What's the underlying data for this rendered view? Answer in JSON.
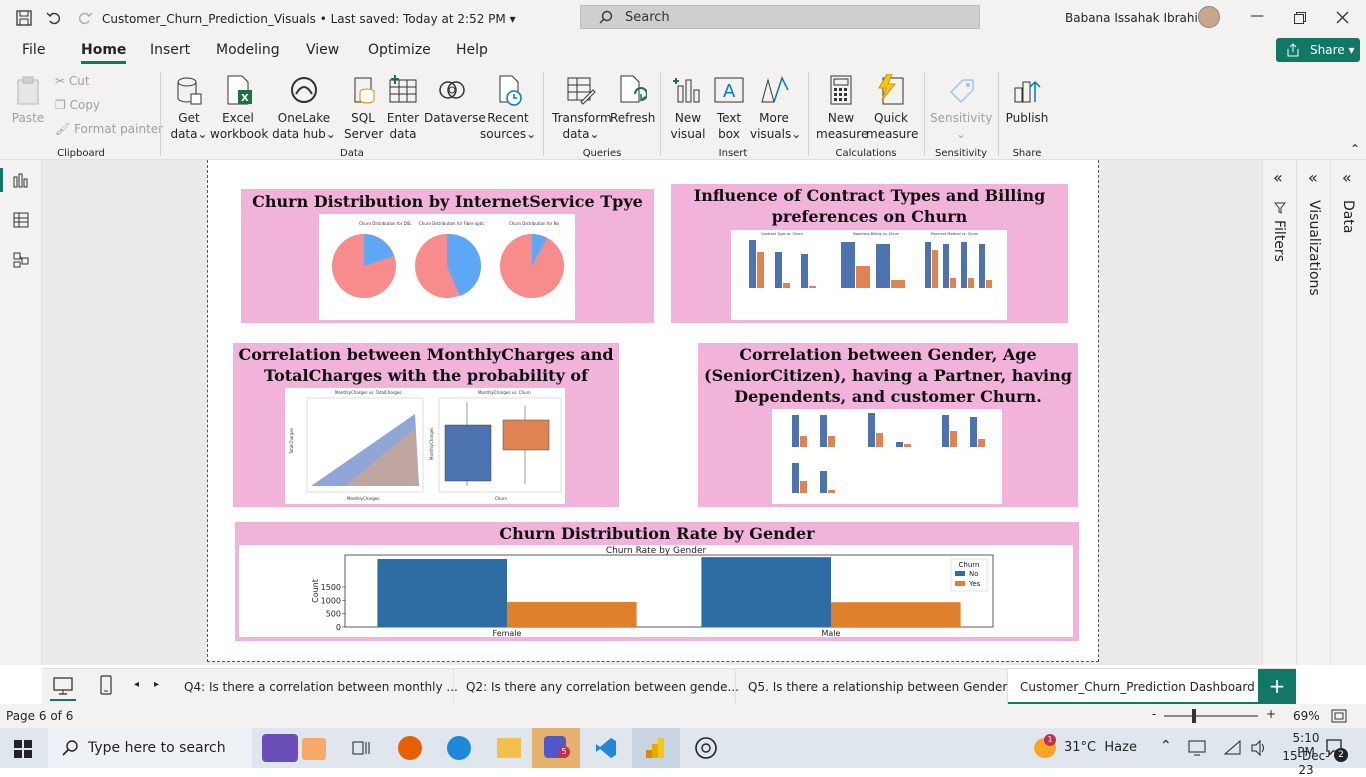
{
  "titlebar": {
    "doc_title": "Customer_Churn_Prediction_Visuals",
    "saved_status": "Last saved: Today at 2:52 PM",
    "search_placeholder": "Search",
    "user_name": "Babana Issahak Ibrahim"
  },
  "ribbon_tabs": [
    "File",
    "Home",
    "Insert",
    "Modeling",
    "View",
    "Optimize",
    "Help"
  ],
  "share_label": "Share",
  "clipboard": {
    "paste": "Paste",
    "cut": "Cut",
    "copy": "Copy",
    "format_painter": "Format painter",
    "group": "Clipboard"
  },
  "data_group": {
    "get_data": "Get data",
    "excel": "Excel workbook",
    "onelake": "OneLake data hub",
    "sql": "SQL Server",
    "enter": "Enter data",
    "dataverse": "Dataverse",
    "recent": "Recent sources",
    "group": "Data"
  },
  "queries": {
    "transform": "Transform data",
    "refresh": "Refresh",
    "group": "Queries"
  },
  "insert": {
    "new_visual": "New visual",
    "text_box": "Text box",
    "more_visuals": "More visuals",
    "group": "Insert"
  },
  "calculations": {
    "new_measure": "New measure",
    "quick_measure": "Quick measure",
    "group": "Calculations"
  },
  "sensitivity": {
    "label": "Sensitivity",
    "group": "Sensitivity"
  },
  "share_group": {
    "publish": "Publish",
    "group": "Share"
  },
  "panels": {
    "p1": {
      "title": "Churn Distribution by InternetService Tpye",
      "pie_titles": [
        "Churn Distribution for DSL",
        "Churn Distribution for Fiber optic",
        "Churn Distribution for No"
      ]
    },
    "p2": {
      "title_line1": "Influence of Contract Types and Billing",
      "title_line2": "preferences on Churn",
      "chart_titles": [
        "Contract Type vs. Churn",
        "Paperless Billing vs. Churn",
        "Payment Method vs. Churn"
      ]
    },
    "p3": {
      "title_line1": "Correlation between MonthlyCharges and",
      "title_line2": "TotalCharges with the probability of churning.",
      "scatter_title": "MonthlyCharges vs. TotalCharges",
      "box_title": "MonthlyCharges vs. Churn",
      "scatter_xlabel": "MonthlyCharges",
      "box_xlabel": "Churn",
      "box_ylabel": "MonthlyCharges",
      "scatter_ylabel": "TotalCharges"
    },
    "p4": {
      "title_line1": "Correlation between Gender, Age",
      "title_line2": "(SeniorCitizen), having a Partner, having",
      "title_line3": "Dependents, and customer Churn."
    },
    "p5": {
      "title": "Churn Distribution Rate by Gender"
    }
  },
  "chart_data": [
    {
      "type": "bar",
      "title": "Churn Rate by Gender",
      "categories": [
        "Female",
        "Male"
      ],
      "series": [
        {
          "name": "No",
          "values": [
            2550,
            2620
          ]
        },
        {
          "name": "Yes",
          "values": [
            940,
            930
          ]
        }
      ],
      "ylabel": "Count",
      "ylim": [
        0,
        2700
      ],
      "yticks": [
        0,
        500,
        1000,
        1500
      ],
      "legend_title": "Churn",
      "legend_position": "top-right",
      "colors": [
        "#2e6da4",
        "#e0802c"
      ]
    }
  ],
  "left_nav": [
    "report-view-icon",
    "table-view-icon",
    "model-view-icon"
  ],
  "right_panes": {
    "filters": "Filters",
    "visualizations": "Visualizations",
    "data": "Data"
  },
  "page_tabs": [
    "Q4: Is there a correlation between monthly ...",
    "Q2: Is there any correlation between gende...",
    "Q5. Is there a relationship between Gender ...",
    "Customer_Churn_Prediction Dashboard"
  ],
  "status": {
    "page": "Page 6 of 6",
    "zoom": "69%"
  },
  "taskbar": {
    "search_placeholder": "Type here to search",
    "weather": "31°C  Haze",
    "time": "5:10 PM",
    "date": "15-Dec-23",
    "notif_count": "2",
    "teams_badge": "5",
    "weather_badge": "1"
  }
}
